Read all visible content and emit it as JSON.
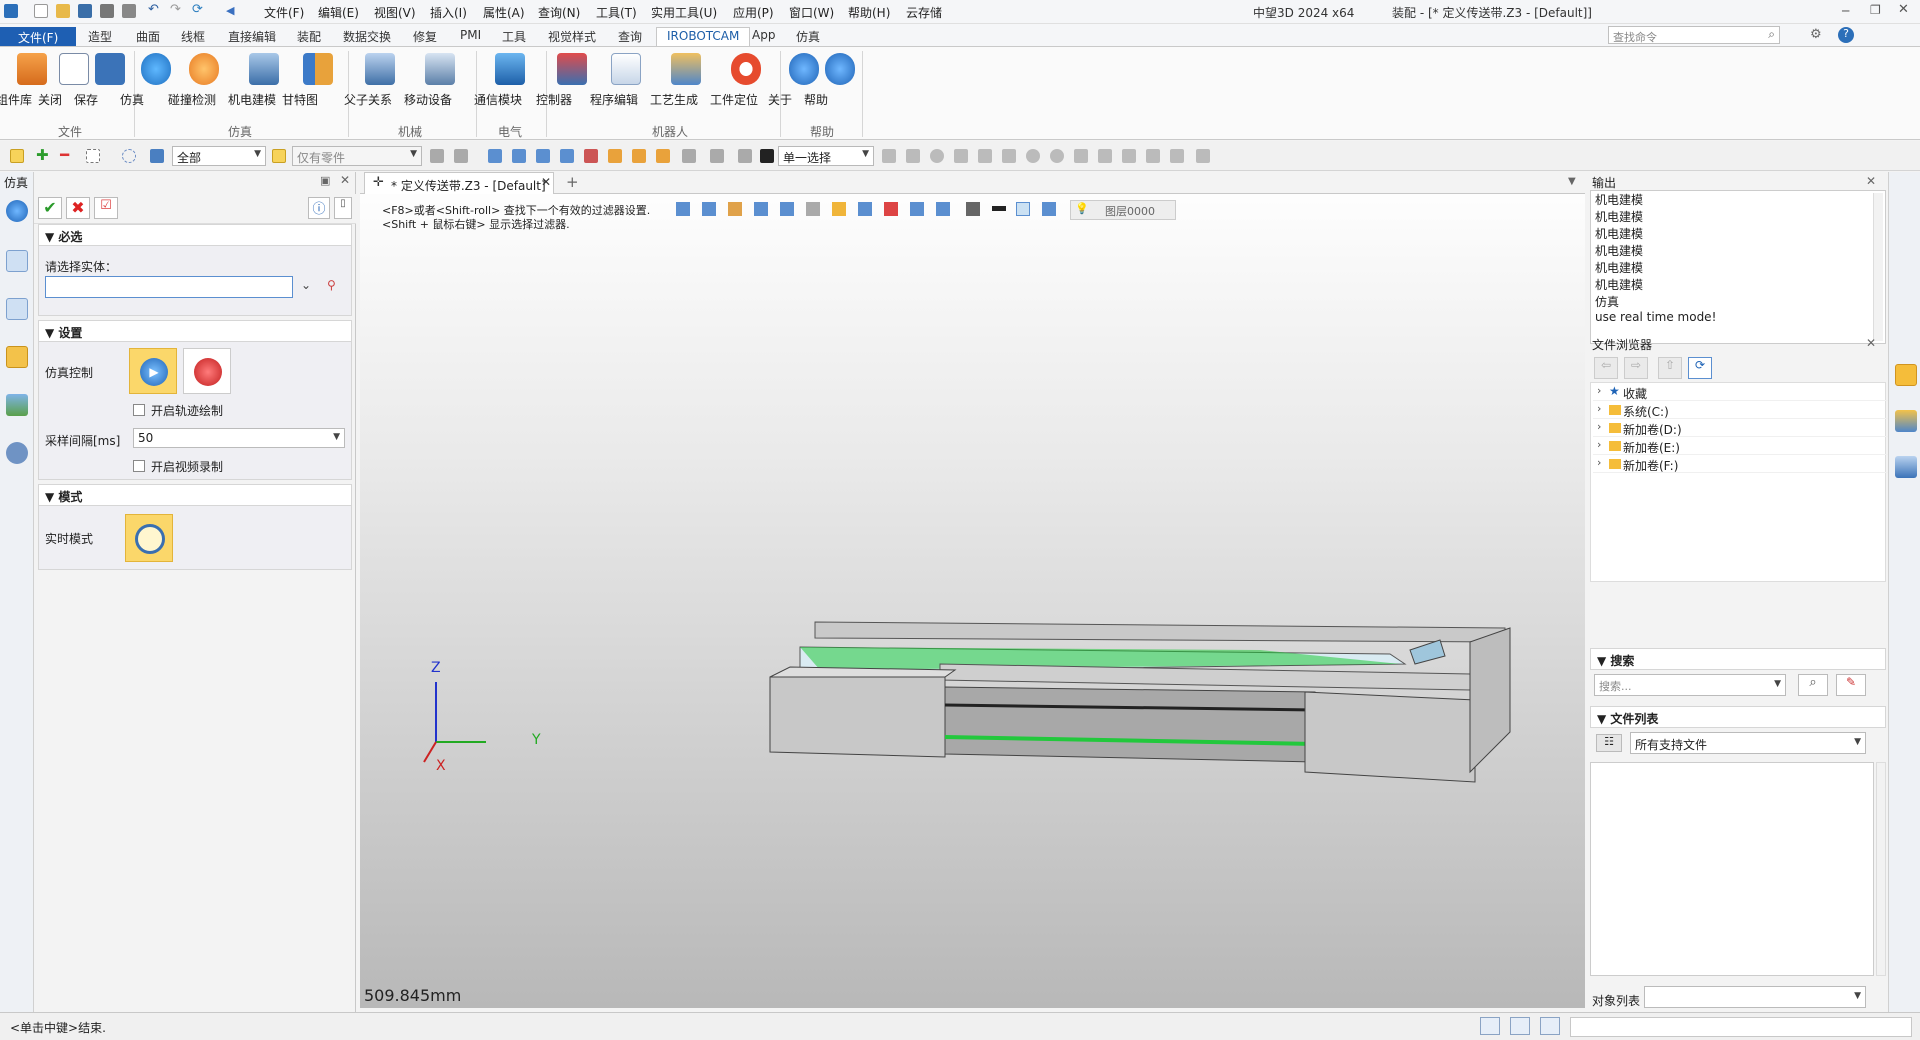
{
  "app_title": "中望3D 2024 x64",
  "doc_title": "装配 - [* 定义传送带.Z3 - [Default]]",
  "menu": [
    "文件(F)",
    "编辑(E)",
    "视图(V)",
    "插入(I)",
    "属性(A)",
    "查询(N)",
    "工具(T)",
    "实用工具(U)",
    "应用(P)",
    "窗口(W)",
    "帮助(H)",
    "云存储"
  ],
  "search_placeholder": "查找命令",
  "ribbon_tabs": [
    "文件(F)",
    "造型",
    "曲面",
    "线框",
    "直接编辑",
    "装配",
    "数据交换",
    "修复",
    "PMI",
    "工具",
    "视觉样式",
    "查询",
    "IROBOTCAM",
    "App",
    "仿真"
  ],
  "ribbon_groups": [
    {
      "label": "文件",
      "buttons": [
        "组件库",
        "关闭",
        "保存"
      ]
    },
    {
      "label": "仿真",
      "buttons": [
        "仿真",
        "碰撞检测",
        "机电建模",
        "甘特图"
      ]
    },
    {
      "label": "机械",
      "buttons": [
        "父子关系",
        "移动设备"
      ]
    },
    {
      "label": "电气",
      "buttons": [
        "通信模块"
      ]
    },
    {
      "label": "机器人",
      "buttons": [
        "控制器",
        "程序编辑",
        "工艺生成",
        "工件定位"
      ]
    },
    {
      "label": "帮助",
      "buttons": [
        "关于",
        "帮助"
      ]
    }
  ],
  "toolbar": {
    "filter_all": "全部",
    "filter_parts": "仅有零件",
    "select_mode": "单一选择"
  },
  "left_panel": {
    "title": "仿真",
    "required_section": "必选",
    "select_entity_label": "请选择实体：",
    "settings_section": "设置",
    "sim_control_label": "仿真控制",
    "enable_trajectory": "开启轨迹绘制",
    "sample_interval_label": "采样间隔[ms]",
    "sample_interval_value": "50",
    "enable_video": "开启视频录制",
    "mode_section": "模式",
    "realtime_label": "实时模式"
  },
  "doc_tab": "* 定义传送带.Z3 - [Default]",
  "viewport": {
    "hint_line1": "<F8>或者<Shift-roll> 查找下一个有效的过滤器设置.",
    "hint_line2": "<Shift + 鼠标右键> 显示选择过滤器.",
    "layer": "图层0000",
    "scale": "509.845mm",
    "axis_x": "X",
    "axis_y": "Y",
    "axis_z": "Z"
  },
  "output": {
    "title": "输出",
    "lines": [
      "机电建模",
      "机电建模",
      "机电建模",
      "机电建模",
      "机电建模",
      "机电建模",
      "仿真",
      "use real time mode!"
    ]
  },
  "file_browser": {
    "title": "文件浏览器",
    "items": [
      "收藏",
      "系统(C:)",
      "新加卷(D:)",
      "新加卷(E:)",
      "新加卷(F:)"
    ]
  },
  "search_section": {
    "title": "搜索",
    "placeholder": "搜索..."
  },
  "file_list": {
    "title": "文件列表",
    "filter": "所有支持文件"
  },
  "object_list_label": "对象列表",
  "status_text": "<单击中键>结束."
}
